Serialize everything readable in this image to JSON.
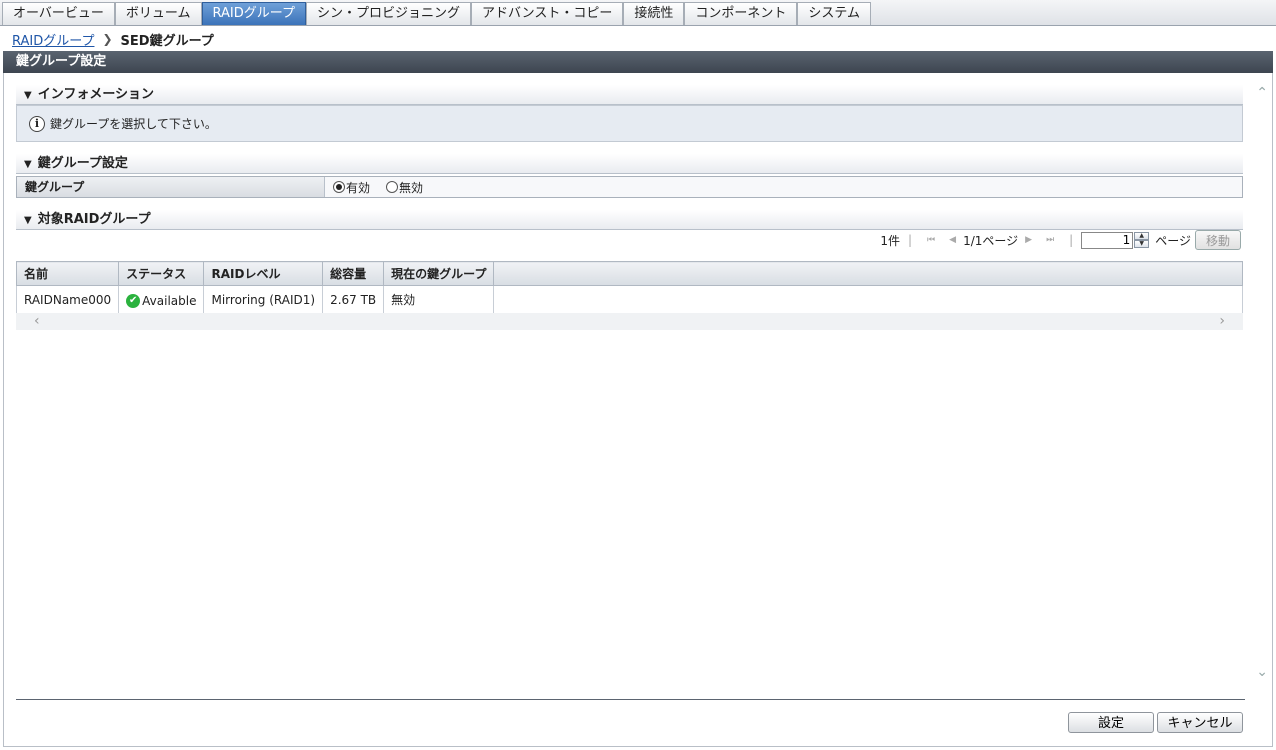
{
  "tabs": [
    {
      "label": "オーバービュー",
      "active": false
    },
    {
      "label": "ボリューム",
      "active": false
    },
    {
      "label": "RAIDグループ",
      "active": true
    },
    {
      "label": "シン・プロビジョニング",
      "active": false
    },
    {
      "label": "アドバンスト・コピー",
      "active": false
    },
    {
      "label": "接続性",
      "active": false
    },
    {
      "label": "コンポーネント",
      "active": false
    },
    {
      "label": "システム",
      "active": false
    }
  ],
  "breadcrumb": {
    "parent": "RAIDグループ",
    "current": "SED鍵グループ"
  },
  "panel_title": "鍵グループ設定",
  "info_section": {
    "title": "インフォメーション",
    "message": "鍵グループを選択して下さい。"
  },
  "key_group_section": {
    "title": "鍵グループ設定",
    "label": "鍵グループ",
    "options": [
      {
        "label": "有効",
        "selected": true
      },
      {
        "label": "無効",
        "selected": false
      }
    ]
  },
  "target_section": {
    "title": "対象RAIDグループ",
    "pager": {
      "count": "1件",
      "page_info": "1/1ページ",
      "page_value": "1",
      "page_label": "ページ",
      "move_label": "移動"
    },
    "columns": [
      "名前",
      "ステータス",
      "RAIDレベル",
      "総容量",
      "現在の鍵グループ"
    ],
    "rows": [
      {
        "name": "RAIDName000",
        "status": "Available",
        "raid_level": "Mirroring (RAID1)",
        "capacity": "2.67 TB",
        "key_group": "無効"
      }
    ]
  },
  "buttons": {
    "set": "設定",
    "cancel": "キャンセル"
  },
  "colors": {
    "active_tab": "#3b73b9",
    "header_bg": "#3d4550",
    "status_ok": "#2bb23e"
  }
}
